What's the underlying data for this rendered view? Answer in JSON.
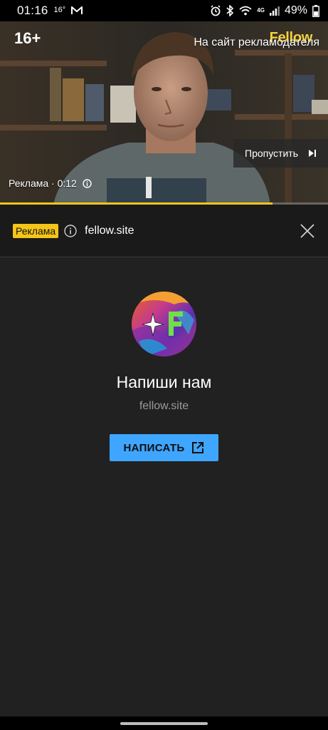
{
  "status_bar": {
    "time": "01:16",
    "temperature": "16°",
    "network": "4G",
    "battery": "49%"
  },
  "video": {
    "age_rating": "16+",
    "brand": "Fellow",
    "advertiser_link": "На сайт рекламодателя",
    "skip_label": "Пропустить",
    "ad_timer": "Реклама · 0:12",
    "progress": 0.83
  },
  "ad_bar": {
    "chip": "Реклама",
    "domain": "fellow.site"
  },
  "ad_card": {
    "title": "Напиши нам",
    "subtitle": "fellow.site",
    "cta_label": "НАПИСАТЬ",
    "cta_color": "#3ea6ff"
  },
  "icons": [
    "message-icon",
    "alarm-icon",
    "bluetooth-icon",
    "wifi-icon",
    "signal-icon",
    "battery-icon",
    "skip-next-icon",
    "info-icon",
    "close-icon",
    "external-link-icon"
  ]
}
